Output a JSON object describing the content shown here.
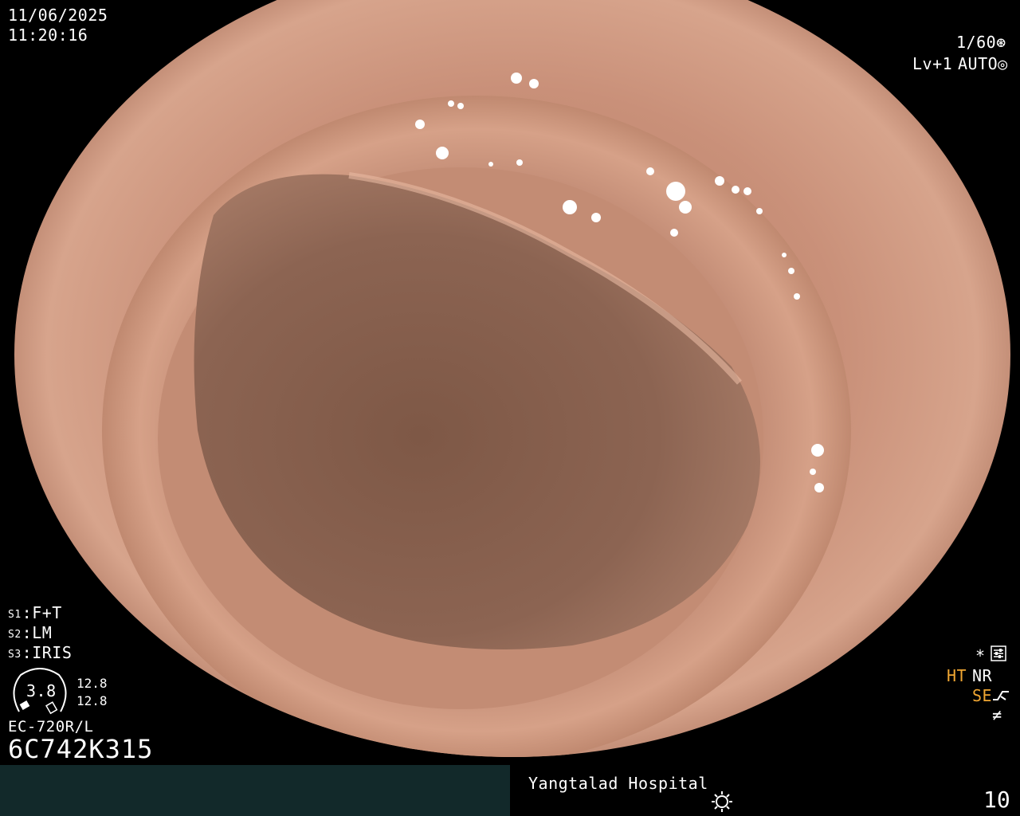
{
  "header": {
    "date": "11/06/2025",
    "time": "11:20:16",
    "shutter": "1/60",
    "level": "Lv+1",
    "iris_mode": "AUTO"
  },
  "settings": {
    "s1_label": "S1",
    "s1_value": "F+T",
    "s2_label": "S2",
    "s2_value": "LM",
    "s3_label": "S3",
    "s3_value": "IRIS"
  },
  "scope": {
    "gauge_value": "3.8",
    "gauge_top": "12.8",
    "gauge_bottom": "12.8",
    "model": "EC-720R/L",
    "serial": "6C742K315"
  },
  "right_panel": {
    "asterisk": "*",
    "ht": "HT",
    "nr": "NR",
    "se": "SE",
    "neq": "≠"
  },
  "footer": {
    "hospital": "Yangtalad Hospital",
    "number": "10"
  },
  "colors": {
    "mucosa_outer": "#c88a70",
    "mucosa_inner": "#8c6350",
    "accent_orange": "#f0a632",
    "bar_teal": "#12292a"
  },
  "icons": {
    "shutter": "aperture-icon",
    "auto": "iris-icon",
    "menu": "settings-sliders-icon",
    "se": "curve-icon",
    "light": "sun-icon"
  }
}
